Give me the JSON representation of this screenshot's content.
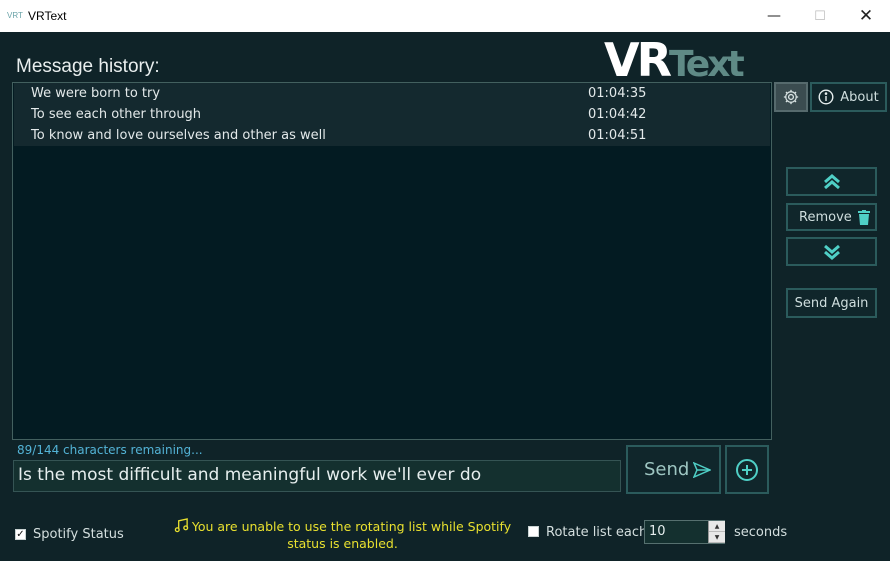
{
  "window": {
    "title": "VRText",
    "app_icon_text": "VRT",
    "minimize_glyph": "—",
    "maximize_glyph": "☐",
    "close_glyph": "✕"
  },
  "logo": {
    "part1": "VR",
    "part2": "Text"
  },
  "history": {
    "heading": "Message history:",
    "rows": [
      {
        "message": "We were born to try",
        "time": "01:04:35"
      },
      {
        "message": "To see each other through",
        "time": "01:04:42"
      },
      {
        "message": "To know and love ourselves and other as well",
        "time": "01:04:51"
      }
    ]
  },
  "side_buttons": {
    "about_label": "About",
    "remove_label": "Remove",
    "send_again_label": "Send Again",
    "icons": {
      "settings": "gear-icon",
      "about": "info-icon",
      "up": "double-chevron-up-icon",
      "remove": "trash-icon",
      "down": "double-chevron-down-icon"
    }
  },
  "composer": {
    "chars_remaining": "89/144 characters remaining...",
    "message_value": "Is the most difficult and meaningful work we'll ever do",
    "send_label": "Send",
    "icons": {
      "send": "send-arrow-icon",
      "add": "plus-circle-icon"
    }
  },
  "footer": {
    "spotify_status_label": "Spotify Status",
    "spotify_status_checked": true,
    "spotify_check_glyph": "✓",
    "warning_text": "You are unable to use the rotating list while Spotify status is enabled.",
    "warning_icon": "music-note-icon",
    "rotate_label": "Rotate list each",
    "rotate_checked": false,
    "rotate_value": "10",
    "spin_up_glyph": "▲",
    "spin_down_glyph": "▼",
    "seconds_label": "seconds"
  },
  "colors": {
    "background": "#0f2328",
    "accent": "#4fcfc6",
    "warning": "#e8e02f",
    "chars_info": "#53b3d6"
  }
}
